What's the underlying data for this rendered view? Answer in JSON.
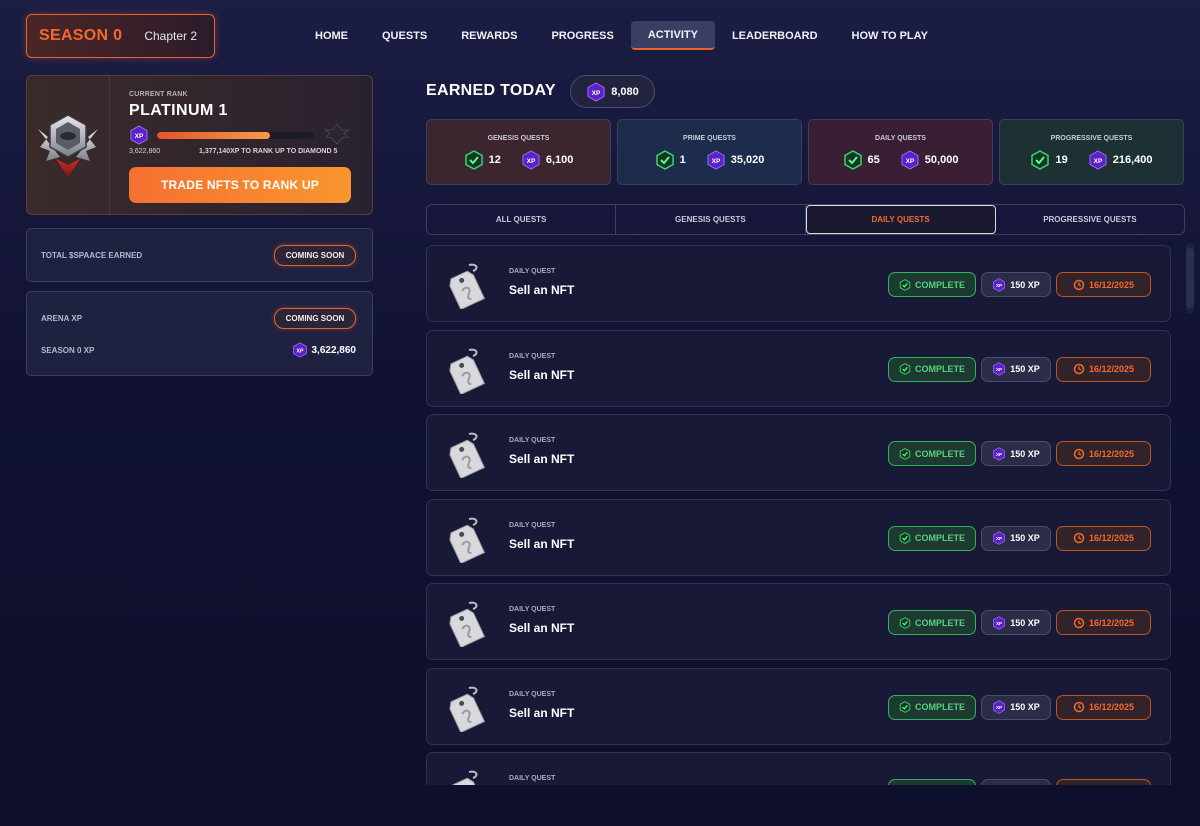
{
  "header": {
    "season_title": "SEASON 0",
    "chapter": "Chapter 2",
    "nav": [
      {
        "label": "HOME",
        "active": false
      },
      {
        "label": "QUESTS",
        "active": false
      },
      {
        "label": "REWARDS",
        "active": false
      },
      {
        "label": "PROGRESS",
        "active": false
      },
      {
        "label": "ACTIVITY",
        "active": true
      },
      {
        "label": "LEADERBOARD",
        "active": false
      },
      {
        "label": "HOW TO PLAY",
        "active": false
      }
    ]
  },
  "rank": {
    "current_label": "CURRENT RANK",
    "name": "PLATINUM 1",
    "xp_badge": "XP",
    "xp_current": "3,622,860",
    "xp_to_next": "1,377,140XP TO RANK UP TO DIAMOND 5",
    "progress_fraction": 0.72,
    "trade_button": "TRADE NFTS TO RANK UP"
  },
  "spaace_panel": {
    "label": "TOTAL $SPAACE EARNED",
    "status": "COMING SOON"
  },
  "arena_panel": {
    "arena_label": "ARENA XP",
    "arena_status": "COMING SOON",
    "season_label": "SEASON 0 XP",
    "season_xp": "3,622,860"
  },
  "earned_today": {
    "title": "EARNED TODAY",
    "xp_badge": "XP",
    "value": "8,080"
  },
  "stats": [
    {
      "label": "GENESIS QUESTS",
      "count": "12",
      "xp": "6,100",
      "color": "#3b2630"
    },
    {
      "label": "PRIME QUESTS",
      "count": "1",
      "xp": "35,020",
      "color": "#1c2c4a"
    },
    {
      "label": "DAILY QUESTS",
      "count": "65",
      "xp": "50,000",
      "color": "#3a1e33"
    },
    {
      "label": "PROGRESSIVE QUESTS",
      "count": "19",
      "xp": "216,400",
      "color": "#1d3134"
    }
  ],
  "tabs": [
    {
      "label": "ALL QUESTS",
      "active": false
    },
    {
      "label": "GENESIS QUESTS",
      "active": false
    },
    {
      "label": "DAILY QUESTS",
      "active": true
    },
    {
      "label": "PROGRESSIVE QUESTS",
      "active": false
    }
  ],
  "quests": [
    {
      "type": "DAILY QUEST",
      "title": "Sell an NFT",
      "status": "COMPLETE",
      "xp": "150 XP",
      "date": "16/12/2025"
    },
    {
      "type": "DAILY QUEST",
      "title": "Sell an NFT",
      "status": "COMPLETE",
      "xp": "150 XP",
      "date": "16/12/2025"
    },
    {
      "type": "DAILY QUEST",
      "title": "Sell an NFT",
      "status": "COMPLETE",
      "xp": "150 XP",
      "date": "16/12/2025"
    },
    {
      "type": "DAILY QUEST",
      "title": "Sell an NFT",
      "status": "COMPLETE",
      "xp": "150 XP",
      "date": "16/12/2025"
    },
    {
      "type": "DAILY QUEST",
      "title": "Sell an NFT",
      "status": "COMPLETE",
      "xp": "150 XP",
      "date": "16/12/2025"
    },
    {
      "type": "DAILY QUEST",
      "title": "Sell an NFT",
      "status": "COMPLETE",
      "xp": "150 XP",
      "date": "16/12/2025"
    },
    {
      "type": "DAILY QUEST",
      "title": "",
      "status": "",
      "xp": "",
      "date": ""
    }
  ],
  "colors": {
    "accent": "#f0692e",
    "complete": "#58d07d",
    "xp_purple": "#6a2bd8"
  }
}
